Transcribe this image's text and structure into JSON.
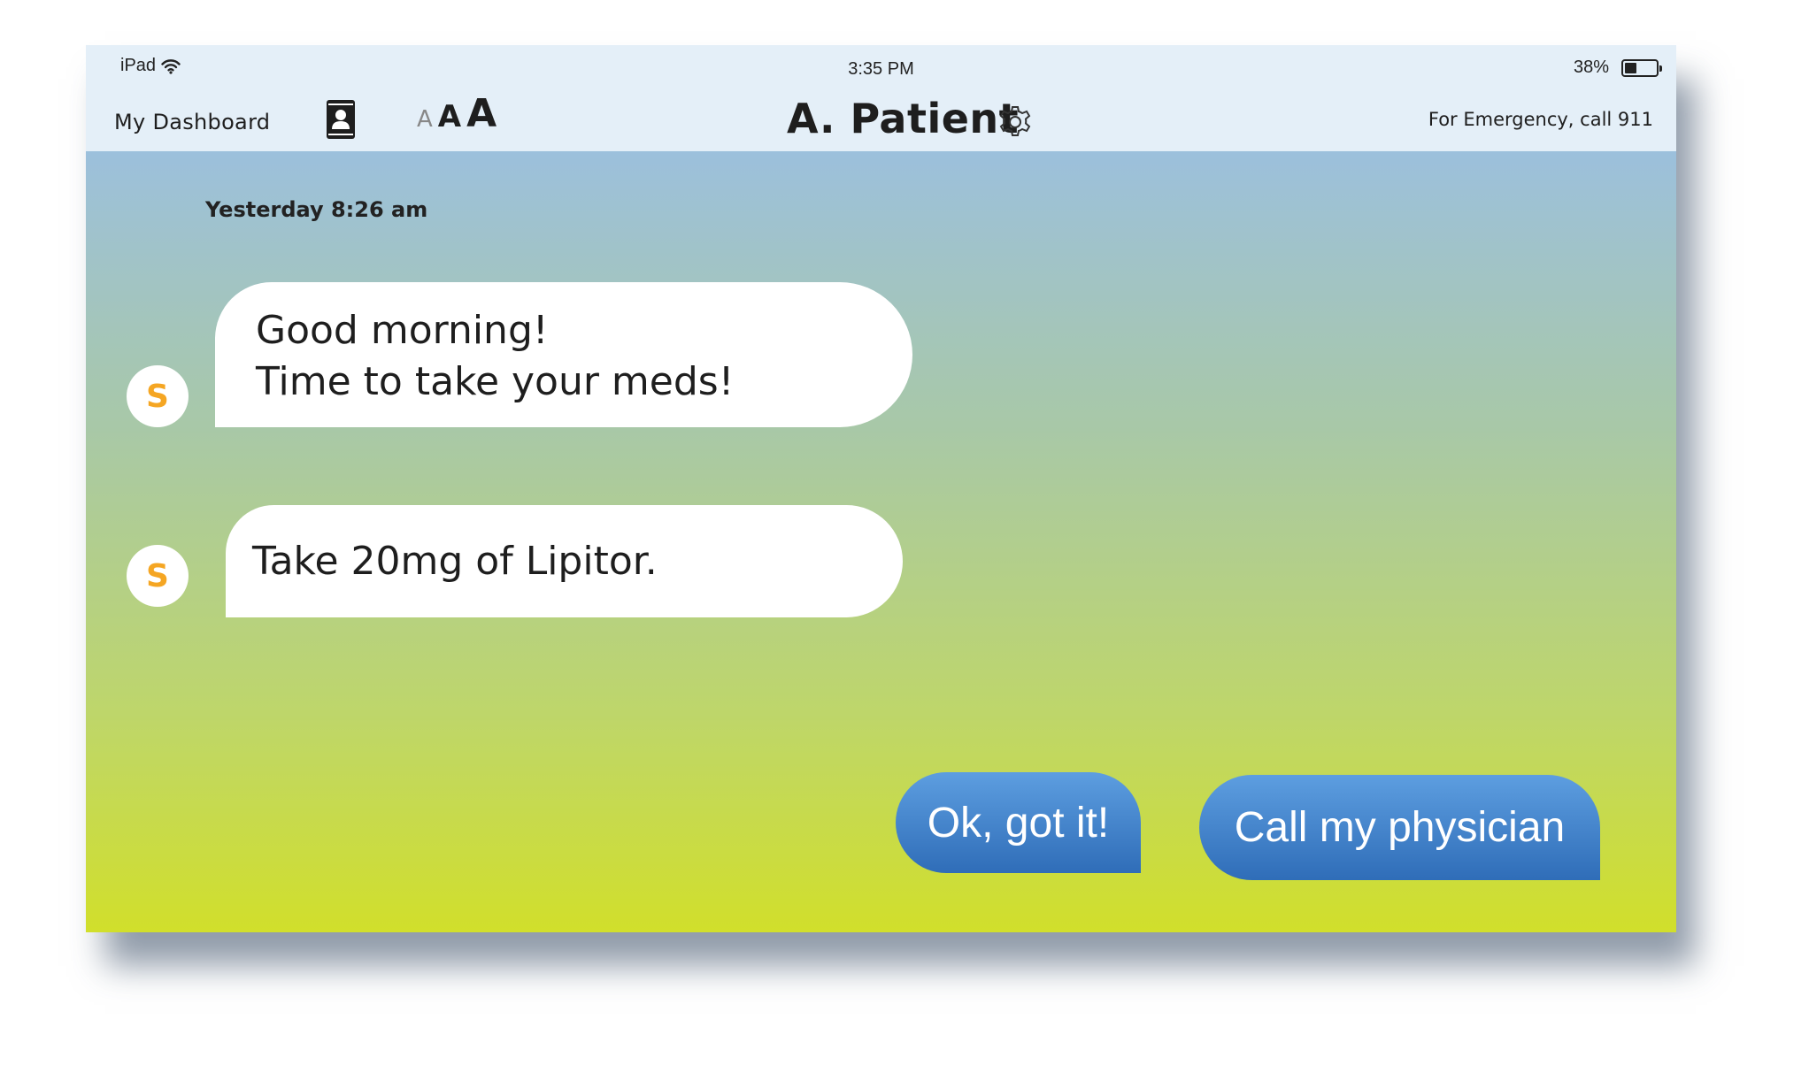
{
  "status_bar": {
    "carrier": "iPad",
    "time": "3:35 PM",
    "battery_percent": "38%",
    "battery_level": 0.38,
    "icons": [
      "wifi-icon",
      "battery-icon"
    ]
  },
  "nav": {
    "dashboard_label": "My Dashboard",
    "contacts_icon": "contacts-icon",
    "font_sizes": {
      "small": "A",
      "medium": "A",
      "large": "A"
    },
    "patient_name": "A. Patient",
    "settings_icon": "gear-icon",
    "emergency_text": "For Emergency, call 911"
  },
  "chat": {
    "timestamp": "Yesterday 8:26 am",
    "messages": [
      {
        "sender_initial": "S",
        "lines": [
          "Good morning!",
          "Time to take your meds!"
        ]
      },
      {
        "sender_initial": "S",
        "lines": [
          "Take 20mg of Lipitor."
        ]
      }
    ],
    "quick_replies": [
      "Ok, got it!",
      "Call my physician"
    ]
  },
  "colors": {
    "header_bg": "#e4eff8",
    "gradient_top": "#9cc0dc",
    "gradient_bottom": "#d1df2b",
    "avatar_letter": "#f5a623",
    "reply_button": "#3f7fcb"
  }
}
